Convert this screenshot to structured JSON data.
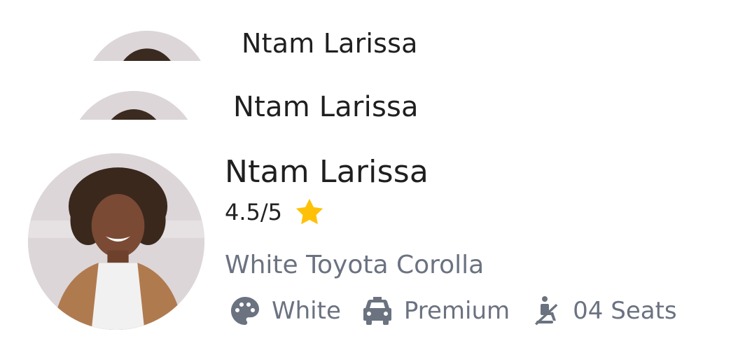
{
  "cards": {
    "card1": {
      "driver_name": "Ntam Larissa"
    },
    "card2": {
      "driver_name": "Ntam Larissa"
    },
    "card3": {
      "driver_name": "Ntam Larissa",
      "rating": "4.5/5",
      "car": "White Toyota Corolla",
      "features": [
        {
          "icon": "palette-icon",
          "label": "White"
        },
        {
          "icon": "taxi-icon",
          "label": "Premium"
        },
        {
          "icon": "seatbelt-icon",
          "label": "04 Seats"
        }
      ]
    }
  },
  "colors": {
    "star": "#FFC107",
    "muted_text": "#6B7280",
    "name_text": "#1F1F1F"
  }
}
